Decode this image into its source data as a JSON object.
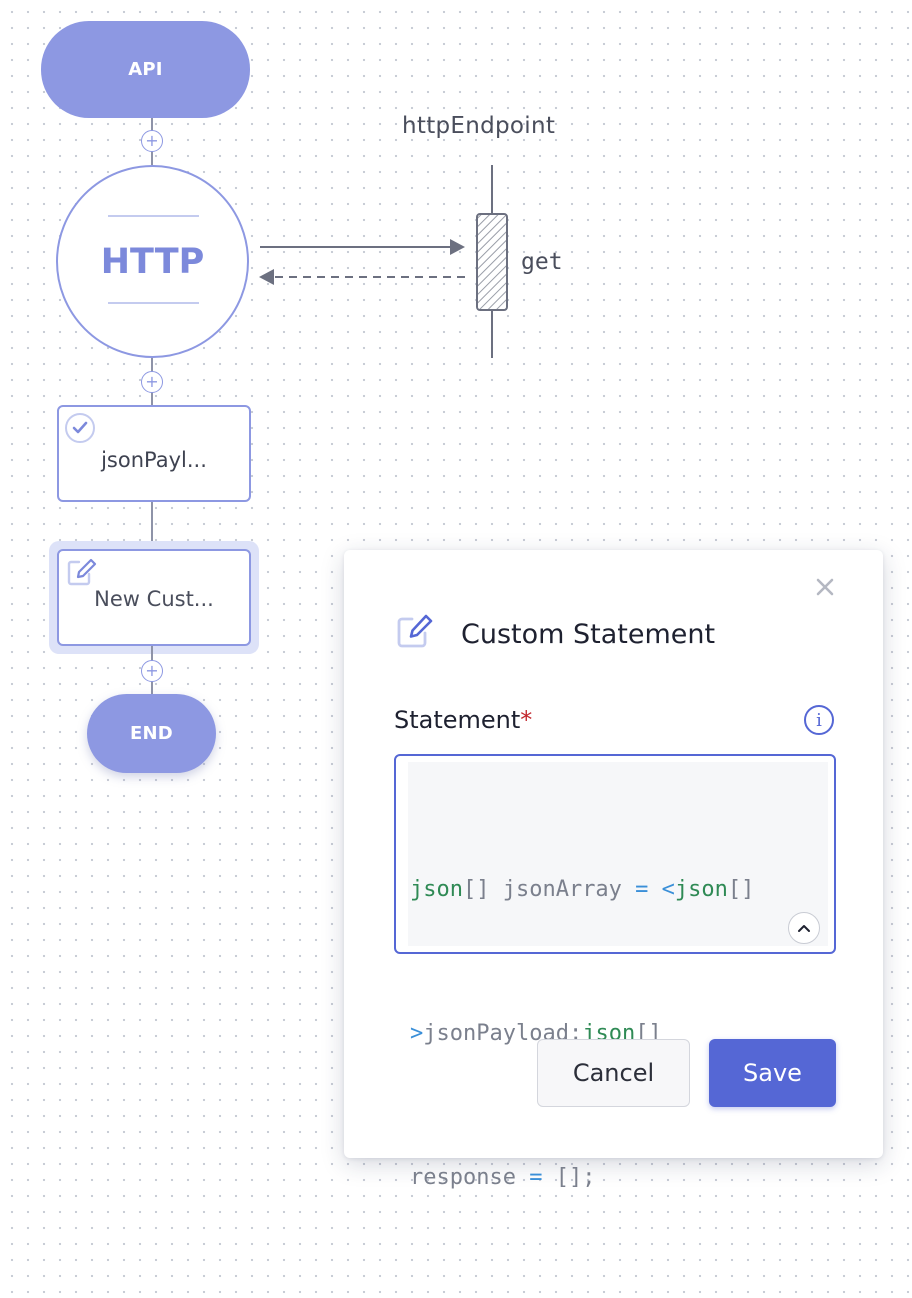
{
  "flow": {
    "start_node": "API",
    "http_node": "HTTP",
    "payload_node": "jsonPayl...",
    "custom_node": "New Cust...",
    "end_node": "END",
    "plus_symbol": "+"
  },
  "endpoint": {
    "name": "httpEndpoint",
    "method": "get"
  },
  "modal": {
    "title": "Custom Statement",
    "close_symbol": "×",
    "field_label": "Statement",
    "required_marker": "*",
    "info_symbol": "i",
    "code": {
      "line1": [
        {
          "t": "json",
          "k": "type"
        },
        {
          "t": "[] jsonArray ",
          "k": "plain"
        },
        {
          "t": "=",
          "k": "op"
        },
        {
          "t": " ",
          "k": "plain"
        },
        {
          "t": "<",
          "k": "op"
        },
        {
          "t": "json",
          "k": "type"
        },
        {
          "t": "[]",
          "k": "plain"
        }
      ],
      "line2": [
        {
          "t": ">",
          "k": "op"
        },
        {
          "t": "jsonPayload;",
          "k": "plain"
        },
        {
          "t": "json",
          "k": "type"
        },
        {
          "t": "[]",
          "k": "plain"
        }
      ],
      "line3": [
        {
          "t": "response ",
          "k": "plain"
        },
        {
          "t": "=",
          "k": "op"
        },
        {
          "t": " [];",
          "k": "plain"
        }
      ]
    },
    "cancel_label": "Cancel",
    "save_label": "Save"
  },
  "colors": {
    "node_fill": "#8d98e2",
    "accent": "#5567d5",
    "required": "#c2272d",
    "code_type": "#2f8a55",
    "code_operator": "#3a8fd8"
  }
}
